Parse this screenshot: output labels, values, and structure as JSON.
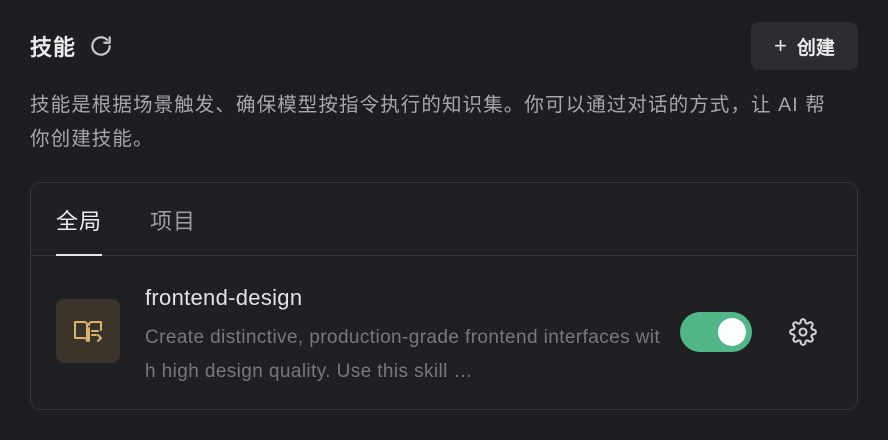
{
  "header": {
    "title": "技能",
    "refresh_icon": "refresh-icon",
    "create_button_label": "创建",
    "create_button_icon": "plus-icon"
  },
  "description": "技能是根据场景触发、确保模型按指令执行的知识集。你可以通过对话的方式，让 AI 帮你创建技能。",
  "tabs": [
    {
      "label": "全局",
      "active": true
    },
    {
      "label": "项目",
      "active": false
    }
  ],
  "skills": [
    {
      "name": "frontend-design",
      "description": "Create distinctive, production-grade frontend interfaces with high design quality. Use this skill …",
      "icon": "book-icon",
      "enabled": true
    }
  ],
  "colors": {
    "background": "#1d1e21",
    "toggle_on": "#52b788",
    "icon_tile": "#3b342a",
    "icon_accent": "#d9b36a"
  }
}
